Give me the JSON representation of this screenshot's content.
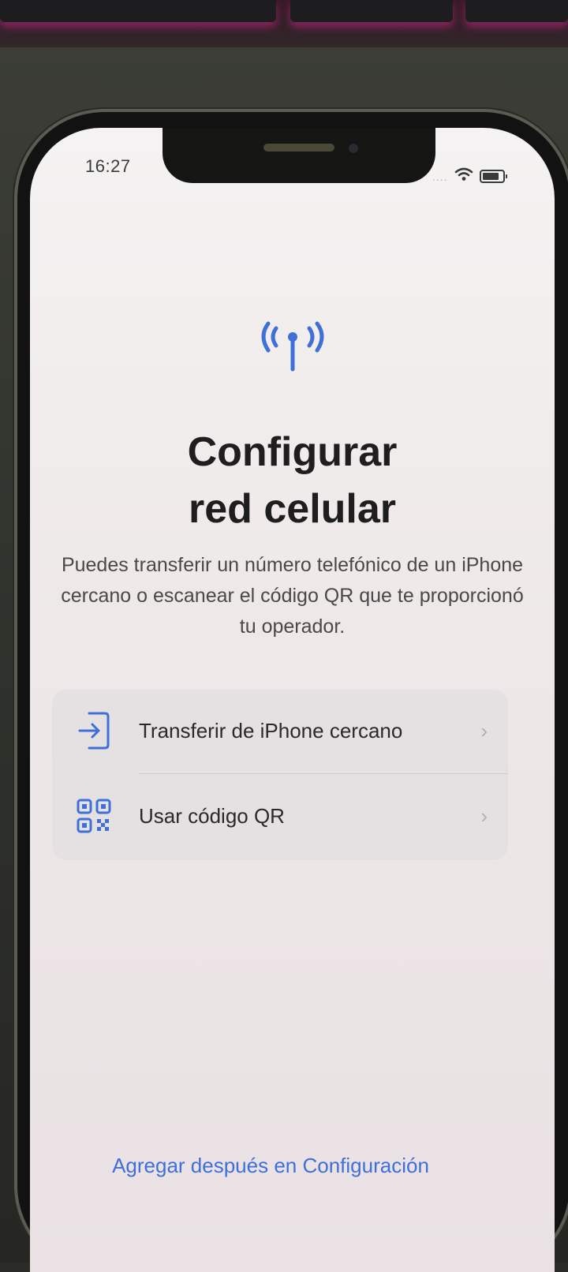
{
  "status_bar": {
    "time": "16:27",
    "signal_dots": "....",
    "wifi_icon": "wifi-icon",
    "battery_icon": "battery-icon"
  },
  "header": {
    "icon": "antenna-icon",
    "title_line1": "Configurar",
    "title_line2": "red celular",
    "description": "Puedes transferir un número telefónico de un iPhone cercano o escanear el código QR que te proporcionó tu operador."
  },
  "options": [
    {
      "label": "Transferir de iPhone cercano",
      "icon": "transfer-icon",
      "chevron": "›"
    },
    {
      "label": "Usar código QR",
      "icon": "qr-code-icon",
      "chevron": "›"
    }
  ],
  "footer": {
    "link": "Agregar después en Configuración"
  },
  "colors": {
    "accent": "#3f70d8",
    "background": "#f2eeee",
    "card": "#e5e0e1"
  }
}
